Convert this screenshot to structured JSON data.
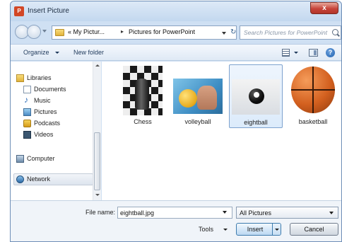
{
  "window": {
    "title": "Insert Picture",
    "close_label": "x",
    "app_icon_letter": "P"
  },
  "address": {
    "crumb_1": "« My Pictur...",
    "separator": "▸",
    "crumb_2": "Pictures for PowerPoint",
    "refresh_glyph": "↻"
  },
  "search": {
    "placeholder": "Search Pictures for PowerPoint"
  },
  "toolbar": {
    "organize_label": "Organize",
    "new_folder_label": "New folder",
    "help_glyph": "?"
  },
  "sidebar": {
    "items": [
      {
        "label": "Libraries",
        "icon": "libraries-icon"
      },
      {
        "label": "Documents",
        "icon": "documents-icon"
      },
      {
        "label": "Music",
        "icon": "music-icon"
      },
      {
        "label": "Pictures",
        "icon": "pictures-icon"
      },
      {
        "label": "Podcasts",
        "icon": "podcasts-icon"
      },
      {
        "label": "Videos",
        "icon": "videos-icon"
      },
      {
        "label": "Computer",
        "icon": "computer-icon"
      },
      {
        "label": "Network",
        "icon": "network-icon"
      }
    ],
    "selected": "Network"
  },
  "files": {
    "items": [
      {
        "label": "Chess"
      },
      {
        "label": "volleyball"
      },
      {
        "label": "eightball"
      },
      {
        "label": "basketball"
      }
    ],
    "selected": "eightball"
  },
  "bottom": {
    "file_name_label": "File name:",
    "file_name_value": "eightball.jpg",
    "file_type_label": "All Pictures",
    "tools_label": "Tools",
    "insert_label": "Insert",
    "cancel_label": "Cancel"
  },
  "colors": {
    "chrome": "#cfe0f3",
    "selection": "#dcebfb",
    "close_button": "#c7443a"
  }
}
